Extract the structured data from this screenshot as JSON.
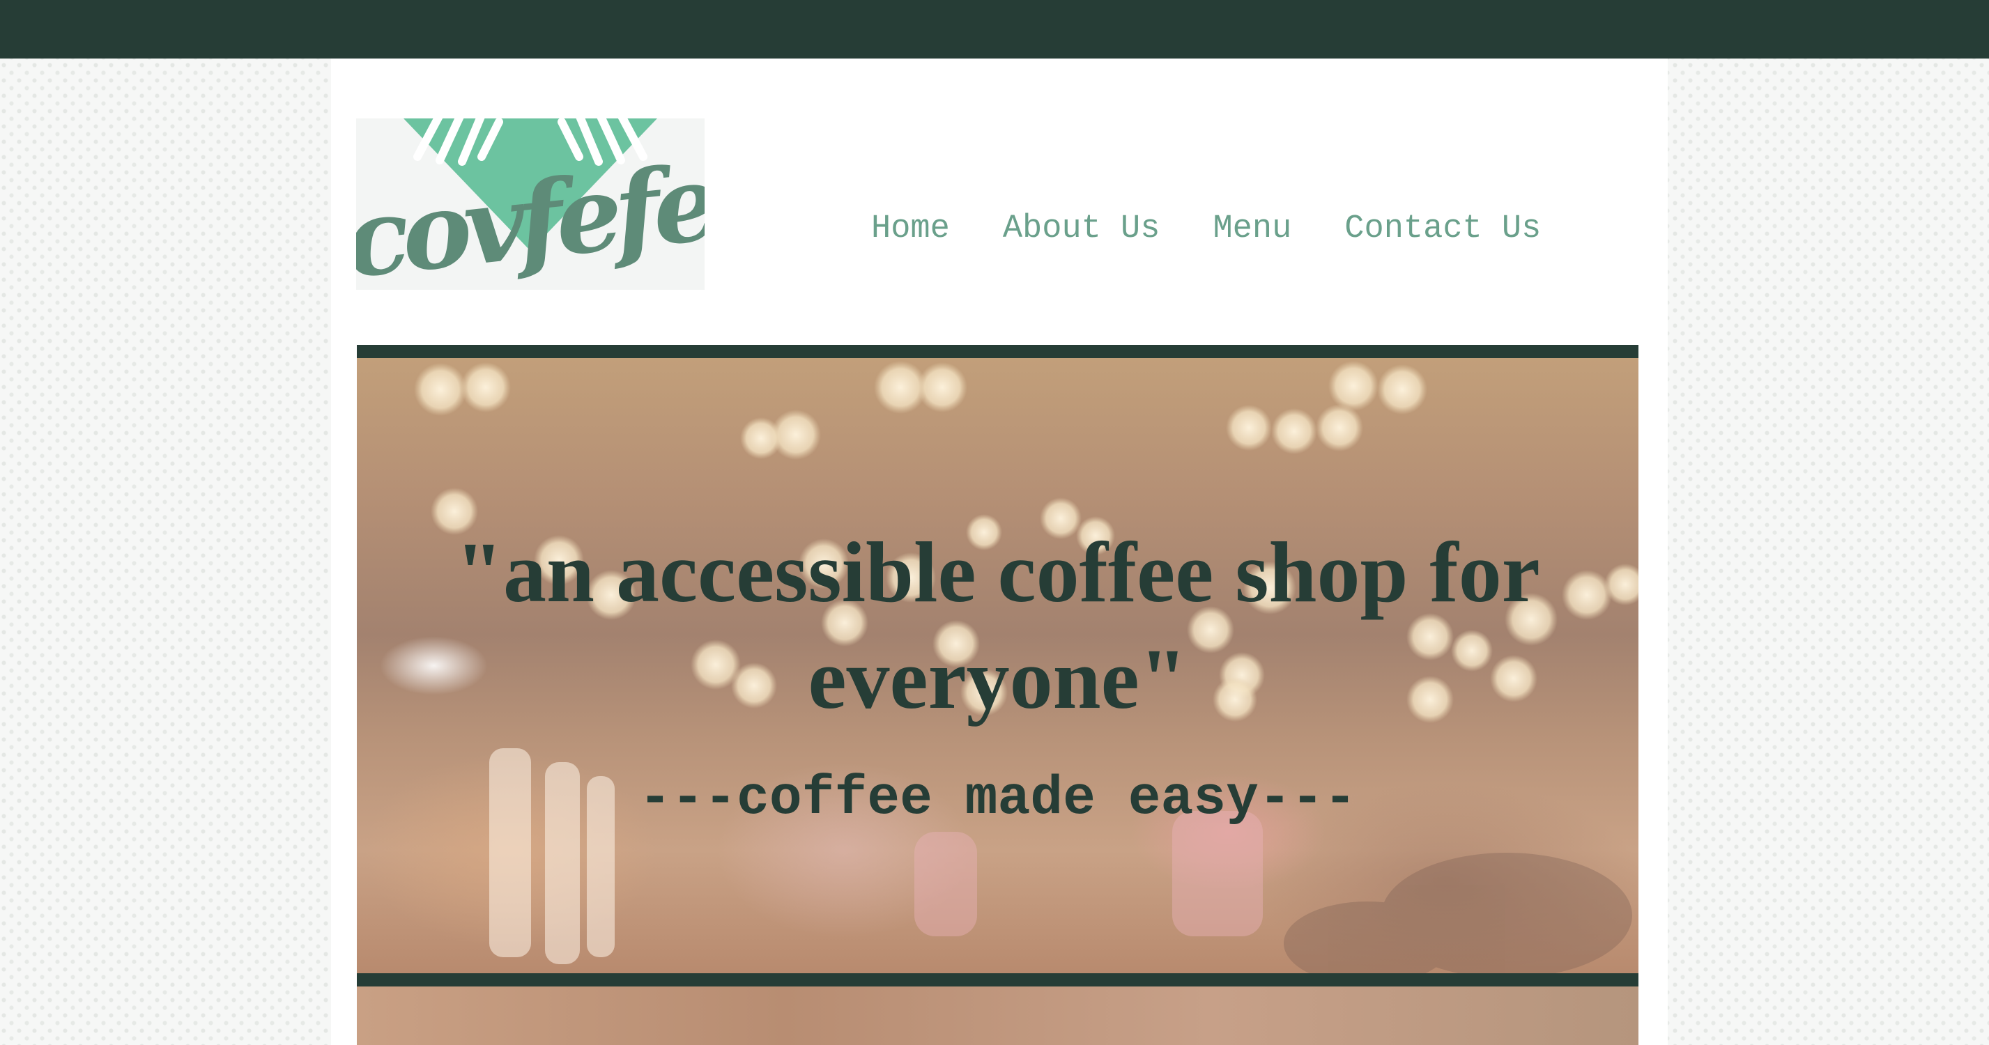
{
  "header": {
    "logo_text": "covfefe",
    "nav": [
      {
        "label": "Home"
      },
      {
        "label": "About Us"
      },
      {
        "label": "Menu"
      },
      {
        "label": "Contact Us"
      }
    ]
  },
  "hero": {
    "quote": "\"an accessible coffee shop for everyone\"",
    "tagline": "---coffee made easy---"
  },
  "colors": {
    "dark_green": "#263d36",
    "accent_green": "#6aa08b",
    "logo_mint": "#6cc3a0",
    "logo_text_green": "#5e8b78"
  },
  "icons": {
    "logo": "covfefe-logo"
  }
}
